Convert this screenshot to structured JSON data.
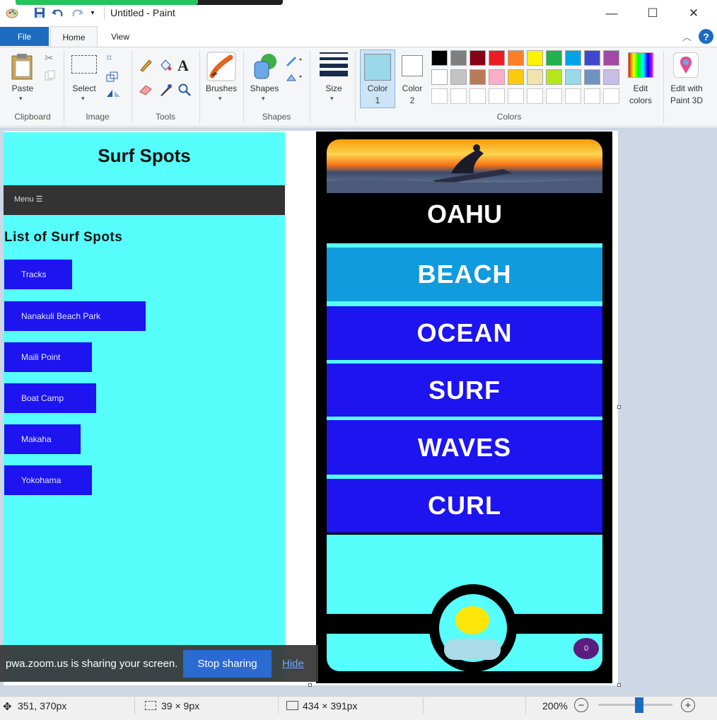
{
  "window": {
    "title": "Untitled - Paint",
    "controls": {
      "minimize": "—",
      "maximize": "☐",
      "close": "✕"
    }
  },
  "quick_access": {
    "icons": [
      "paint-app-icon",
      "save-icon",
      "undo-icon",
      "redo-icon",
      "customize-icon"
    ]
  },
  "tabs": [
    {
      "label": "File"
    },
    {
      "label": "Home"
    },
    {
      "label": "View"
    }
  ],
  "ribbon": {
    "clipboard": {
      "group": "Clipboard",
      "paste": "Paste"
    },
    "image": {
      "group": "Image",
      "select": "Select"
    },
    "tools": {
      "group": "Tools"
    },
    "brushes": {
      "label": "Brushes"
    },
    "shapes": {
      "group": "Shapes",
      "label": "Shapes"
    },
    "size": {
      "label": "Size"
    },
    "colors": {
      "group": "Colors",
      "color1": "Color\n1",
      "color1_line1": "Color",
      "color1_line2": "1",
      "color2_line1": "Color",
      "color2_line2": "2",
      "edit_line1": "Edit",
      "edit_line2": "colors",
      "palette_row1": [
        "#000000",
        "#7f7f7f",
        "#880015",
        "#ed1c24",
        "#ff7f27",
        "#fff200",
        "#22b14c",
        "#00a2e8",
        "#3f48cc",
        "#a349a4"
      ],
      "palette_row2": [
        "#ffffff",
        "#c3c3c3",
        "#b97a57",
        "#ffaec9",
        "#ffc90e",
        "#efe4b0",
        "#b5e61d",
        "#99d9ea",
        "#7092be",
        "#c8bfe7"
      ]
    },
    "paint3d": {
      "line1": "Edit with",
      "line2": "Paint 3D"
    }
  },
  "canvas": {
    "left_page": {
      "title": "Surf Spots",
      "menu": "Menu ☰",
      "list_title": "List of Surf Spots",
      "spots": [
        "Tracks",
        "Nanakuli Beach Park",
        "Maili Point",
        "Boat Camp",
        "Makaha",
        "Yokohama"
      ]
    },
    "phone": {
      "island": "OAHU",
      "bands": [
        {
          "label": "BEACH",
          "color": "#109bdf"
        },
        {
          "label": "OCEAN",
          "color": "#1d14f0"
        },
        {
          "label": "SURF",
          "color": "#1d14f0"
        },
        {
          "label": "WAVES",
          "color": "#1d14f0"
        },
        {
          "label": "CURL",
          "color": "#1d14f0"
        }
      ],
      "badge": "0"
    }
  },
  "share_banner": {
    "text": "pwa.zoom.us is sharing your screen.",
    "stop": "Stop sharing",
    "hide": "Hide"
  },
  "status": {
    "cursor": "351, 370px",
    "selection": "39 × 9px",
    "canvas_size": "434 × 391px",
    "zoom": "200%"
  },
  "accent": "#1c6bbf"
}
